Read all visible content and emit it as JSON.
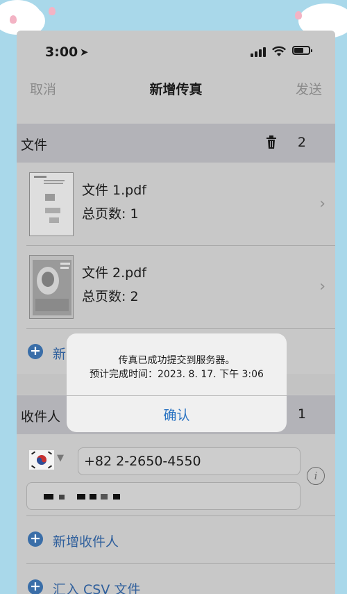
{
  "status_bar": {
    "time": "3:00",
    "location_icon": "location-arrow-icon",
    "signal_icon": "cellular-signal-icon",
    "wifi_icon": "wifi-icon",
    "battery_icon": "battery-icon"
  },
  "nav": {
    "cancel": "取消",
    "title": "新增传真",
    "send": "发送"
  },
  "files_section": {
    "label": "文件",
    "count": "2",
    "trash_icon": "trash-icon",
    "items": [
      {
        "name": "文件 1.pdf",
        "pages": "总页数: 1"
      },
      {
        "name": "文件 2.pdf",
        "pages": "总页数: 2"
      }
    ],
    "add_label_partial": "新"
  },
  "recipients_section": {
    "label": "收件人",
    "count": "1",
    "flag_icon": "south-korea-flag-icon",
    "phone": "+82 2-2650-4550",
    "add_recipient": "新增收件人",
    "import_csv": "汇入 CSV 文件"
  },
  "alert": {
    "title": "传真已成功提交到服务器。",
    "message": "预计完成时间：2023. 8. 17. 下午 3:06",
    "confirm": "确认"
  },
  "colors": {
    "background": "#a9d8ea",
    "dimmed_screen": "#c8c8c8",
    "link_blue": "#2f5f9c",
    "alert_button": "#2a73c2"
  }
}
